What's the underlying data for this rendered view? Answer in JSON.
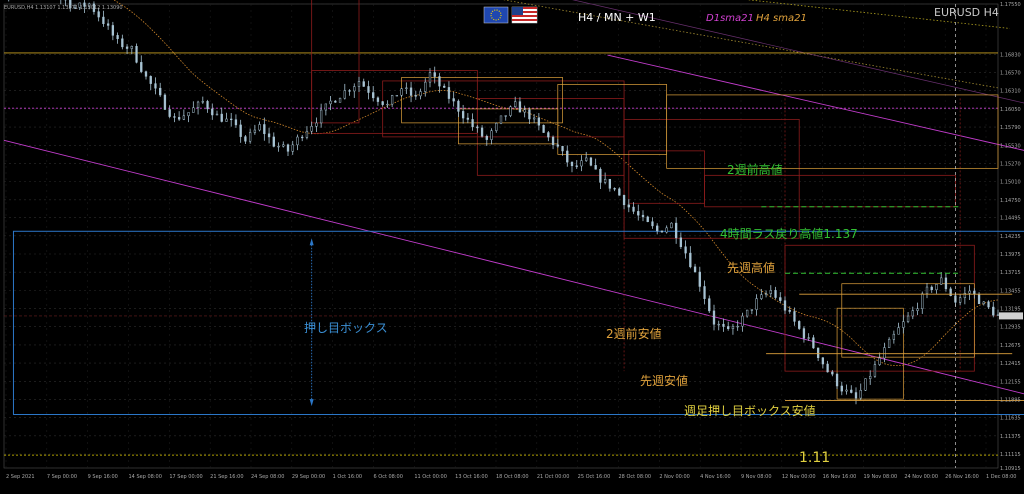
{
  "window": {
    "info": "EURUSD,H4  1.13107 1.13271 1.13012 1.13090",
    "timeframes": "H4 / MN + W1",
    "sma_d1": "D1sma21",
    "sma_h4": "H4 sma21",
    "symbol": "EURUSD H4"
  },
  "annotations": {
    "two_weeks_high": "2週前高値",
    "h4_last_pullback": "4時間ラス戻り高値1.137",
    "last_week_high": "先週高値",
    "pullback_box": "押し目ボックス",
    "two_weeks_low": "2週前安値",
    "last_week_low": "先週安値",
    "weekly_box_low": "週足押し目ボックス安値",
    "level_111": "1.11"
  },
  "colors": {
    "background": "#000000",
    "candles": "#a8c4d4",
    "box": "#2b77c8",
    "green": "#33c233",
    "orange": "#e0a23c",
    "magenta": "#c23ccc",
    "yellow": "#d8d000",
    "red": "#8c1c1c"
  },
  "chart_data": {
    "type": "candlestick",
    "symbol": "EURUSD",
    "timeframe": "H4",
    "ylim": [
      1.10915,
      1.1755
    ],
    "y_ticks": [
      1.1755,
      1.1683,
      1.1657,
      1.1631,
      1.1605,
      1.1579,
      1.1553,
      1.1527,
      1.1501,
      1.1475,
      1.14495,
      1.14235,
      1.13975,
      1.13715,
      1.13455,
      1.13195,
      1.12935,
      1.12675,
      1.12415,
      1.12155,
      1.11895,
      1.11635,
      1.11375,
      1.11115,
      1.10915
    ],
    "y_tick_labels": [
      "1.17550",
      "1.16830",
      "1.16570",
      "1.16310",
      "1.16050",
      "1.15790",
      "1.15530",
      "1.15270",
      "1.15010",
      "1.14750",
      "1.14495",
      "1.14235",
      "1.13975",
      "1.13715",
      "1.13455",
      "1.13195",
      "1.12935",
      "1.12675",
      "1.12415",
      "1.12155",
      "1.11895",
      "1.11635",
      "1.11375",
      "1.11115",
      "1.10915"
    ],
    "x_labels": [
      "2 Sep 2021",
      "7 Sep 00:00",
      "9 Sep 16:00",
      "14 Sep 08:00",
      "17 Sep 00:00",
      "21 Sep 16:00",
      "24 Sep 08:00",
      "29 Sep 00:00",
      "1 Oct 16:00",
      "6 Oct 08:00",
      "11 Oct 00:00",
      "13 Oct 16:00",
      "18 Oct 08:00",
      "21 Oct 00:00",
      "25 Oct 16:00",
      "28 Oct 08:00",
      "2 Nov 00:00",
      "4 Nov 16:00",
      "9 Nov 08:00",
      "12 Nov 00:00",
      "16 Nov 16:00",
      "19 Nov 08:00",
      "24 Nov 00:00",
      "26 Nov 16:00",
      "1 Dec 08:00"
    ],
    "close_path": [
      [
        0,
        1.177
      ],
      [
        6,
        1.1785
      ],
      [
        12,
        1.1795
      ],
      [
        18,
        1.178
      ],
      [
        24,
        1.1765
      ],
      [
        30,
        1.175
      ],
      [
        36,
        1.1755
      ],
      [
        42,
        1.173
      ],
      [
        48,
        1.17
      ],
      [
        54,
        1.169
      ],
      [
        60,
        1.165
      ],
      [
        66,
        1.162
      ],
      [
        72,
        1.159
      ],
      [
        78,
        1.16
      ],
      [
        84,
        1.1615
      ],
      [
        90,
        1.1595
      ],
      [
        96,
        1.1585
      ],
      [
        102,
        1.156
      ],
      [
        108,
        1.158
      ],
      [
        114,
        1.1555
      ],
      [
        120,
        1.1545
      ],
      [
        126,
        1.157
      ],
      [
        132,
        1.159
      ],
      [
        138,
        1.1615
      ],
      [
        144,
        1.163
      ],
      [
        150,
        1.1645
      ],
      [
        156,
        1.1625
      ],
      [
        162,
        1.161
      ],
      [
        168,
        1.1635
      ],
      [
        174,
        1.162
      ],
      [
        180,
        1.1655
      ],
      [
        186,
        1.163
      ],
      [
        192,
        1.1605
      ],
      [
        198,
        1.158
      ],
      [
        204,
        1.156
      ],
      [
        210,
        1.159
      ],
      [
        216,
        1.161
      ],
      [
        222,
        1.1595
      ],
      [
        228,
        1.157
      ],
      [
        234,
        1.155
      ],
      [
        240,
        1.152
      ],
      [
        246,
        1.153
      ],
      [
        252,
        1.1505
      ],
      [
        258,
        1.149
      ],
      [
        264,
        1.1465
      ],
      [
        270,
        1.1445
      ],
      [
        276,
        1.143
      ],
      [
        282,
        1.144
      ],
      [
        288,
        1.14
      ],
      [
        294,
        1.1355
      ],
      [
        300,
        1.13
      ],
      [
        306,
        1.1285
      ],
      [
        312,
        1.1305
      ],
      [
        318,
        1.133
      ],
      [
        324,
        1.1345
      ],
      [
        330,
        1.132
      ],
      [
        336,
        1.129
      ],
      [
        342,
        1.1265
      ],
      [
        348,
        1.123
      ],
      [
        354,
        1.1205
      ],
      [
        360,
        1.119
      ],
      [
        366,
        1.1225
      ],
      [
        372,
        1.126
      ],
      [
        378,
        1.129
      ],
      [
        384,
        1.1315
      ],
      [
        390,
        1.1345
      ],
      [
        396,
        1.136
      ],
      [
        402,
        1.133
      ],
      [
        408,
        1.1345
      ],
      [
        414,
        1.1325
      ],
      [
        420,
        1.1309
      ]
    ],
    "levels": {
      "two_weeks_high": 1.1465,
      "h4_last_pullback_high": 1.137,
      "last_week_high": 1.134,
      "two_weeks_low": 1.1255,
      "last_week_low": 1.1188,
      "weekly_box_low": 1.116,
      "level_111": 1.111,
      "current_price": 1.1309
    },
    "grid": true
  }
}
